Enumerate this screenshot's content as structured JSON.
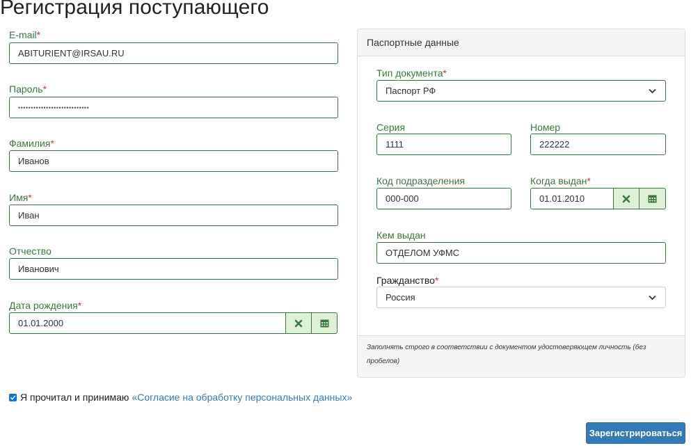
{
  "page": {
    "title": "Регистрация поступающего"
  },
  "form": {
    "email": {
      "label": "E-mail",
      "required_mark": "*",
      "value": "ABITURIENT@IRSAU.RU"
    },
    "password": {
      "label": "Пароль",
      "required_mark": "*",
      "value": "••••••••••••••••••••••••••••"
    },
    "last_name": {
      "label": "Фамилия",
      "required_mark": "*",
      "value": "Иванов"
    },
    "first_name": {
      "label": "Имя",
      "required_mark": "*",
      "value": "Иван"
    },
    "patronymic": {
      "label": "Отчество",
      "value": "Иванович"
    },
    "birth_date": {
      "label": "Дата рождения",
      "required_mark": "*",
      "value": "01.01.2000"
    }
  },
  "passport": {
    "heading": "Паспортные данные",
    "doc_type": {
      "label": "Тип документа",
      "required_mark": "*",
      "value": "Паспорт РФ"
    },
    "series": {
      "label": "Серия",
      "value": "1111"
    },
    "number": {
      "label": "Номер",
      "value": "222222"
    },
    "division_code": {
      "label": "Код подразделения",
      "value": "000-000"
    },
    "issue_date": {
      "label": "Когда выдан",
      "required_mark": "*",
      "value": "01.01.2010"
    },
    "issued_by": {
      "label": "Кем выдан",
      "value": "ОТДЕЛОМ УФМС"
    },
    "citizenship": {
      "label": "Гражданство",
      "required_mark": "*",
      "value": "Россия"
    },
    "note": "Заполнять строго в соответствии с документом удостоверяющем личность (без пробелов)"
  },
  "consent": {
    "checked": true,
    "text": "Я прочитал и принимаю",
    "link": "«Согласие на обработку персональных данных»"
  },
  "submit_label": "Зарегистрироваться",
  "icons": {
    "clear": "times-icon",
    "calendar": "calendar-icon",
    "select": "chevron-down-icon",
    "check": "check-icon"
  },
  "colors": {
    "label_green": "#3c763d",
    "required_red": "#a94442",
    "addon_bg": "#dff0d8",
    "primary": "#337ab7"
  }
}
